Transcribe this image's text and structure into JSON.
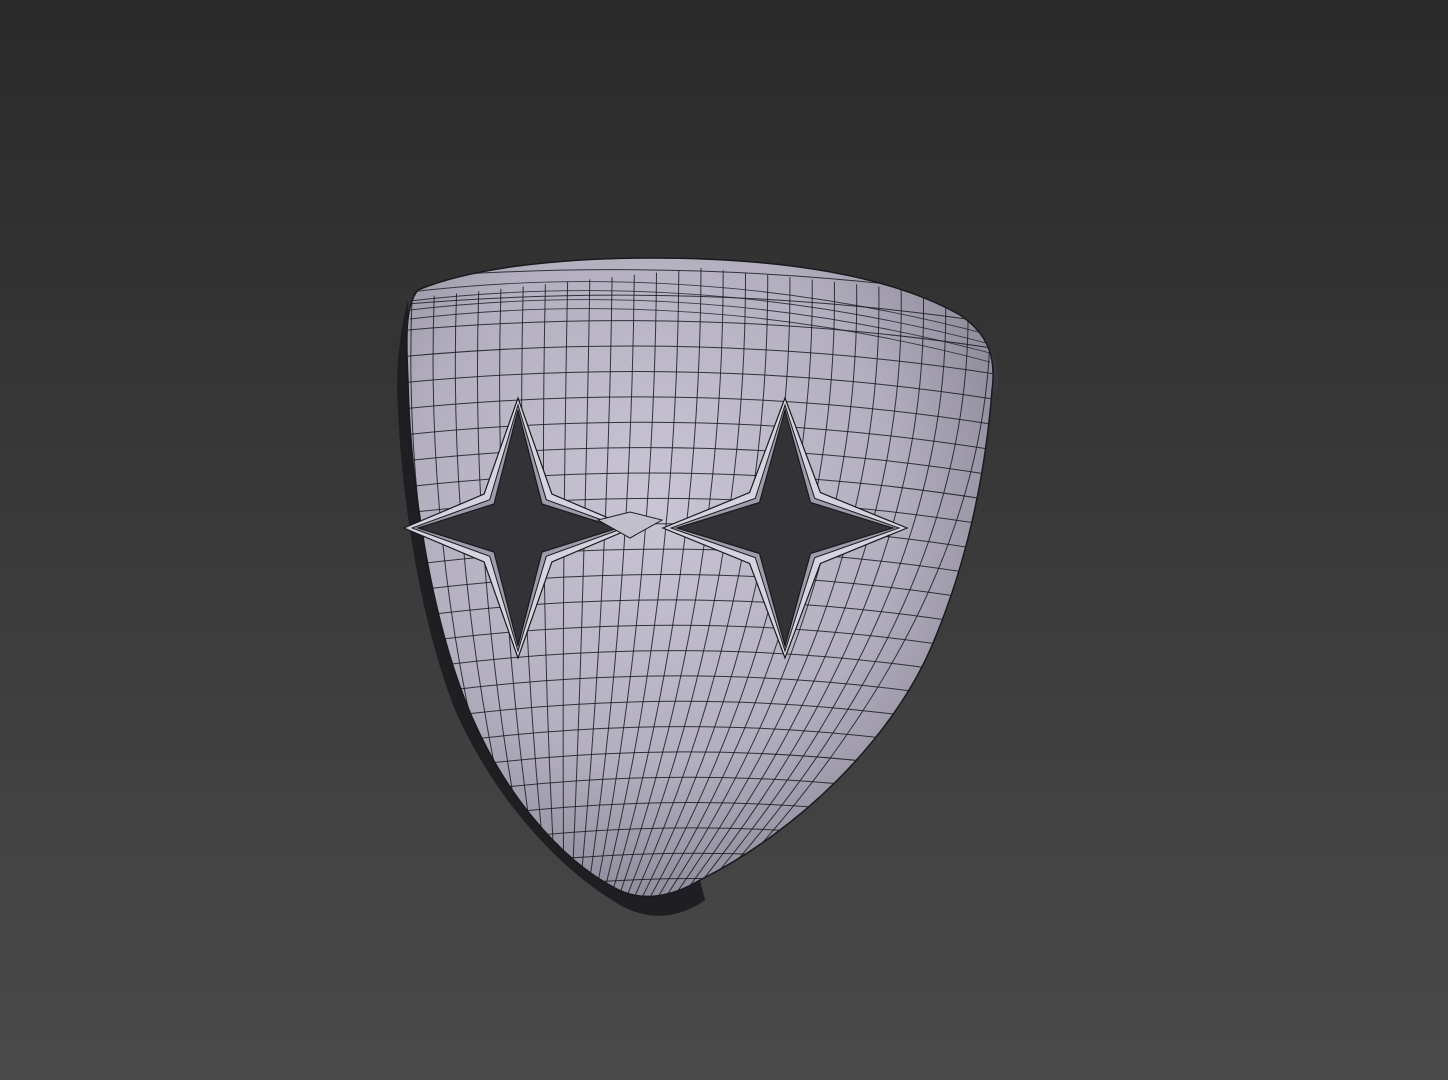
{
  "viewport": {
    "background_top": "#2a2a2a",
    "background_bottom": "#4a4a4a",
    "model": {
      "name": "mask-mesh",
      "surface_color": "#b7b3c2",
      "shadow_color": "#4d4b55",
      "edge_color": "#1a1a1e",
      "wireframe": true,
      "eye_holes": "four-point-star"
    }
  }
}
